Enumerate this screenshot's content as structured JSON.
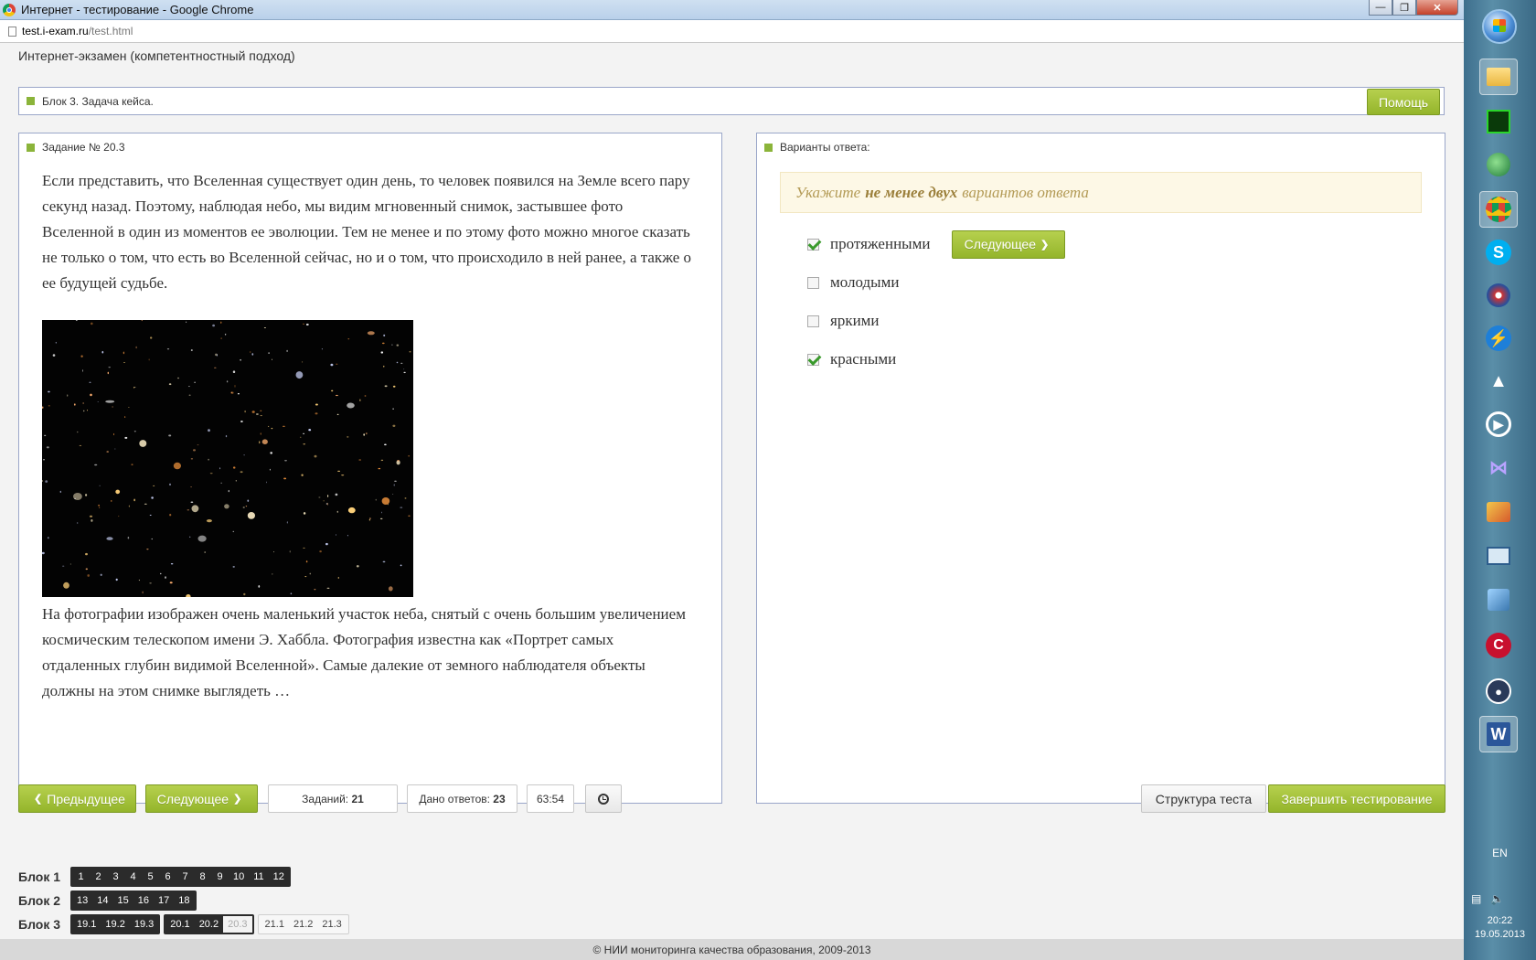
{
  "window": {
    "title": "Интернет - тестирование - Google Chrome",
    "url_host": "test.i-exam.ru",
    "url_path": "/test.html"
  },
  "app": {
    "header": "Интернет-экзамен (компетентностный подход)",
    "block_title": "Блок 3. Задача кейса.",
    "help_label": "Помощь"
  },
  "task": {
    "title": "Задание № 20.3",
    "text_1": "Если представить, что Вселенная существует один день, то человек появился на Земле всего пару секунд назад. Поэтому, наблюдая небо, мы видим мгновенный снимок, застывшее фото Вселенной в один из моментов ее эволюции. Тем не менее и по этому фото можно многое сказать не только о том, что есть во Вселенной сейчас, но и о том, что происходило в ней ранее, а также о ее будущей судьбе.",
    "text_2": "На фотографии изображен очень маленький участок неба, снятый с очень большим увеличением космическим телескопом имени Э. Хаббла. Фотография известна как «Портрет самых отдаленных глубин видимой Вселенной». Самые далекие от земного наблюдателя объекты должны на этом снимке выглядеть …"
  },
  "answers": {
    "title": "Варианты ответа:",
    "hint_pre": "Укажите",
    "hint_bold": "не менее двух",
    "hint_post": "вариантов ответа",
    "next_inline_label": "Следующее",
    "options": [
      {
        "label": "протяженными",
        "checked": true
      },
      {
        "label": "молодыми",
        "checked": false
      },
      {
        "label": "яркими",
        "checked": false
      },
      {
        "label": "красными",
        "checked": true
      }
    ]
  },
  "controls": {
    "prev_label": "Предыдущее",
    "next_label": "Следующее",
    "tasks_label": "Заданий:",
    "tasks_value": "21",
    "answered_label": "Дано ответов:",
    "answered_value": "23",
    "timer": "63:54",
    "structure_label": "Структура теста",
    "finish_label": "Завершить тестирование"
  },
  "blocks": [
    {
      "label": "Блок 1",
      "groups": [
        {
          "style": "dark",
          "items": [
            "1",
            "2",
            "3",
            "4",
            "5",
            "6",
            "7",
            "8",
            "9",
            "10",
            "11",
            "12"
          ]
        }
      ]
    },
    {
      "label": "Блок 2",
      "groups": [
        {
          "style": "dark",
          "items": [
            "13",
            "14",
            "15",
            "16",
            "17",
            "18"
          ]
        }
      ]
    },
    {
      "label": "Блок 3",
      "groups": [
        {
          "style": "dark",
          "items": [
            "19.1",
            "19.2",
            "19.3"
          ]
        },
        {
          "style": "dark",
          "items": [
            "20.1",
            "20.2"
          ],
          "current": "20.3"
        },
        {
          "style": "light",
          "items": [
            "21.1",
            "21.2",
            "21.3"
          ]
        }
      ]
    }
  ],
  "footer": "© НИИ мониторинга качества образования, 2009-2013",
  "taskbar": {
    "lang": "EN",
    "time": "20:22",
    "date": "19.05.2013"
  },
  "colors": {
    "accent_green": "#94b52b",
    "panel_border": "#9aa6c9",
    "hint_bg": "#fdf8e6",
    "check_green": "#3a9a2c"
  }
}
